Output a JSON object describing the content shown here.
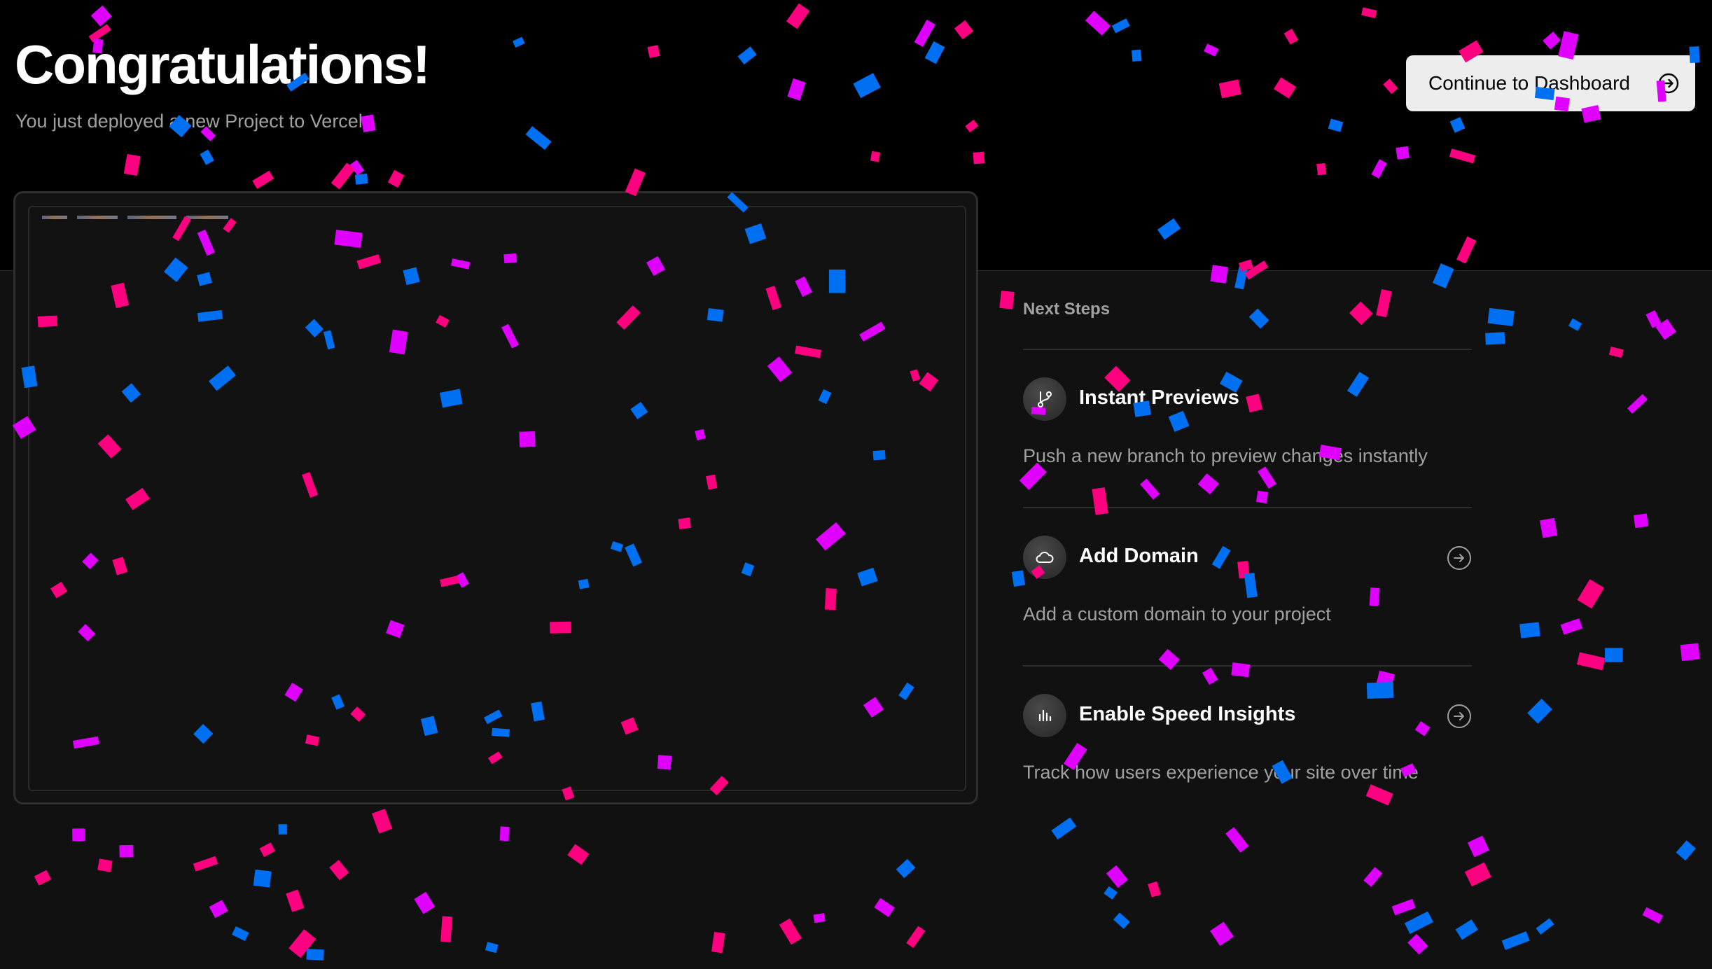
{
  "header": {
    "title": "Congratulations!",
    "subtitle": "You just deployed a new Project to Vercel.",
    "continue_button": {
      "label": "Continue to Dashboard",
      "icon": "arrow-right-circle-icon"
    }
  },
  "preview": {
    "label": "deployment-preview"
  },
  "next_steps": {
    "heading": "Next Steps",
    "items": [
      {
        "title": "Instant Previews",
        "description": "Push a new branch to preview changes instantly",
        "icon": "git-branch-icon",
        "has_arrow": false
      },
      {
        "title": "Add Domain",
        "description": "Add a custom domain to your project",
        "icon": "cloud-icon",
        "has_arrow": true
      },
      {
        "title": "Enable Speed Insights",
        "description": "Track how users experience your site over time",
        "icon": "bar-chart-icon",
        "has_arrow": true
      }
    ]
  },
  "colors": {
    "background": "#000000",
    "panel": "#111111",
    "button_bg": "#ededed",
    "muted_text": "#a1a1a1",
    "confetti_blue": "#0070f3",
    "confetti_pink": "#ff0080",
    "confetti_magenta": "#e000ff"
  }
}
